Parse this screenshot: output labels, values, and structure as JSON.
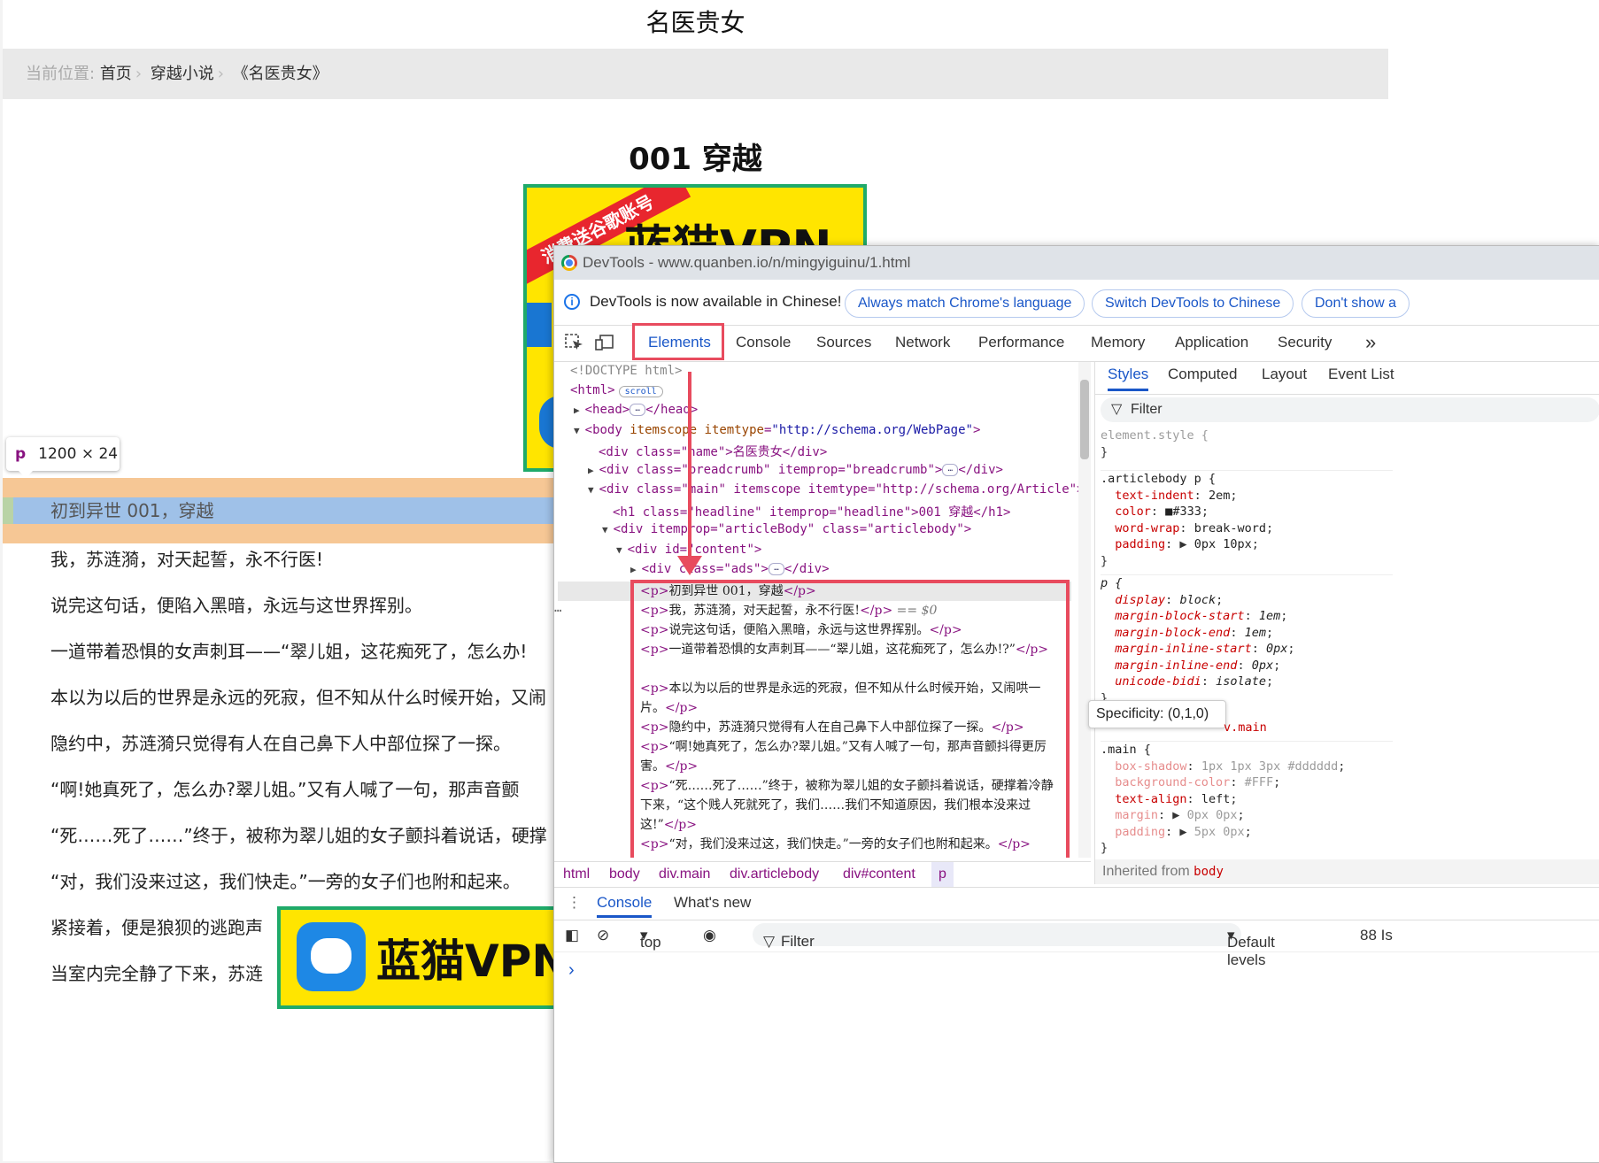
{
  "page": {
    "site_name": "名医贵女",
    "breadcrumb": {
      "label": "当前位置:",
      "items": [
        "首页",
        "穿越小说",
        "《名医贵女》"
      ],
      "separator": "›"
    },
    "headline": "001 穿越",
    "ad_top": {
      "ribbon": "消费送谷歌账号",
      "brand": "蓝猫VPN"
    },
    "ad_bottom": {
      "brand": "蓝猫VPN"
    },
    "inspect_tooltip": {
      "tag": "p",
      "size": "1200 × 24"
    },
    "highlighted_paragraph": "初到异世 001，穿越",
    "paragraphs": [
      "我，苏涟漪，对天起誓，永不行医!",
      "说完这句话，便陷入黑暗，永远与这世界挥别。",
      "一道带着恐惧的女声刺耳——“翠儿姐，这花痴死了，怎么办!",
      "本以为以后的世界是永远的死寂，但不知从什么时候开始，又闹",
      "隐约中，苏涟漪只觉得有人在自己鼻下人中部位探了一探。",
      "“啊!她真死了，怎么办?翠儿姐。”又有人喊了一句，那声音颤",
      "“死……死了……”终于，被称为翠儿姐的女子颤抖着说话，硬撑",
      "“对，我们没来过这，我们快走。”一旁的女子们也附和起来。",
      "紧接着，便是狼狈的逃跑声",
      "当室内完全静了下来，苏涟"
    ]
  },
  "devtools": {
    "title": "DevTools - www.quanben.io/n/mingyiguinu/1.html",
    "infobar": {
      "message": "DevTools is now available in Chinese!",
      "btn_match": "Always match Chrome's language",
      "btn_switch": "Switch DevTools to Chinese",
      "btn_dont": "Don't show a"
    },
    "tabs": [
      "Elements",
      "Console",
      "Sources",
      "Network",
      "Performance",
      "Memory",
      "Application",
      "Security"
    ],
    "active_tab": "Elements",
    "more_tabs": "»",
    "dom": {
      "doctype": "<!DOCTYPE html>",
      "html_open": "<html>",
      "html_badge": "scroll",
      "head": "<head>",
      "head_close": "</head>",
      "body_tag": "body",
      "body_attr1": "itemscope",
      "body_attr2": "itemtype",
      "body_attr2_val": "\"http://schema.org/WebPage\"",
      "div_name": "<div class=\"name\">名医贵女</div>",
      "div_breadcrumb": "<div class=\"breadcrumb\" itemprop=\"breadcrumb\">",
      "div_main": "<div class=\"main\" itemscope itemtype=\"http://schema.org/Article\">",
      "h1": "<h1 class=\"headline\" itemprop=\"headline\">001 穿越</h1>",
      "div_articlebody": "<div itemprop=\"articleBody\" class=\"articlebody\">",
      "div_content": "<div id=\"content\">",
      "div_ads": "<div class=\"ads\">",
      "div_close": "</div>",
      "selected_suffix": "== $0"
    },
    "p_lines": [
      {
        "text": "初到异世 001，穿越",
        "selected": false
      },
      {
        "text": "我，苏涟漪，对天起誓，永不行医!",
        "selected": true
      },
      {
        "text": "说完这句话，便陷入黑暗，永远与这世界挥别。",
        "selected": false
      },
      {
        "text": "一道带着恐惧的女声刺耳——“翠儿姐，这花痴死了，怎么办!?”",
        "selected": false
      },
      {
        "text": "本以为以后的世界是永远的死寂，但不知从什么时候开始，又闹哄一片。",
        "selected": false
      },
      {
        "text": "隐约中，苏涟漪只觉得有人在自己鼻下人中部位探了一探。",
        "selected": false
      },
      {
        "text": "“啊!她真死了，怎么办?翠儿姐。”又有人喊了一句，那声音颤抖得更厉害。",
        "selected": false
      },
      {
        "text": "“死……死了……”终于，被称为翠儿姐的女子颤抖着说话，硬撑着冷静下来，“这个贱人死就死了，我们……我们不知道原因，我们根本没来过这!”",
        "selected": false
      },
      {
        "text": "“对，我们没来过这，我们快走。”一旁的女子们也附和起来。",
        "selected": false
      }
    ],
    "breadcrumb_path": [
      "html",
      "body",
      "div.main",
      "div.articlebody",
      "div#content",
      "p"
    ],
    "styles": {
      "tabs": [
        "Styles",
        "Computed",
        "Layout",
        "Event List"
      ],
      "filter": "Filter",
      "element_style": "element.style {",
      "rule1_sel": ".articlebody p {",
      "rule1": [
        [
          "text-indent",
          "2em"
        ],
        [
          "color",
          "#333"
        ],
        [
          "word-wrap",
          "break-word"
        ],
        [
          "padding",
          "0px 10px"
        ]
      ],
      "rule2_sel": "p {",
      "rule2": [
        [
          "display",
          "block"
        ],
        [
          "margin-block-start",
          "1em"
        ],
        [
          "margin-block-end",
          "1em"
        ],
        [
          "margin-inline-start",
          "0px"
        ],
        [
          "margin-inline-end",
          "0px"
        ],
        [
          "unicode-bidi",
          "isolate"
        ]
      ],
      "specificity": "Specificity: (0,1,0)",
      "rule3_hint": "v.main",
      "rule3_sel": ".main {",
      "rule3": [
        [
          "box-shadow",
          "1px 1px 3px #dddddd"
        ],
        [
          "background-color",
          "#FFF"
        ],
        [
          "text-align",
          "left"
        ],
        [
          "margin",
          "0px 0px"
        ],
        [
          "padding",
          "5px 0px"
        ]
      ],
      "inherited_label": "Inherited from",
      "inherited_from": "body"
    },
    "drawer": {
      "tabs": [
        "Console",
        "What's new"
      ],
      "context": "top",
      "filter": "Filter",
      "levels": "Default levels",
      "issues": "88 Is",
      "prompt": "›"
    },
    "colors": {
      "highlight_red": "#e84b5e",
      "accent_blue": "#1a57c8",
      "ad_yellow": "#ffe500",
      "ad_green": "#1faa6a"
    }
  }
}
